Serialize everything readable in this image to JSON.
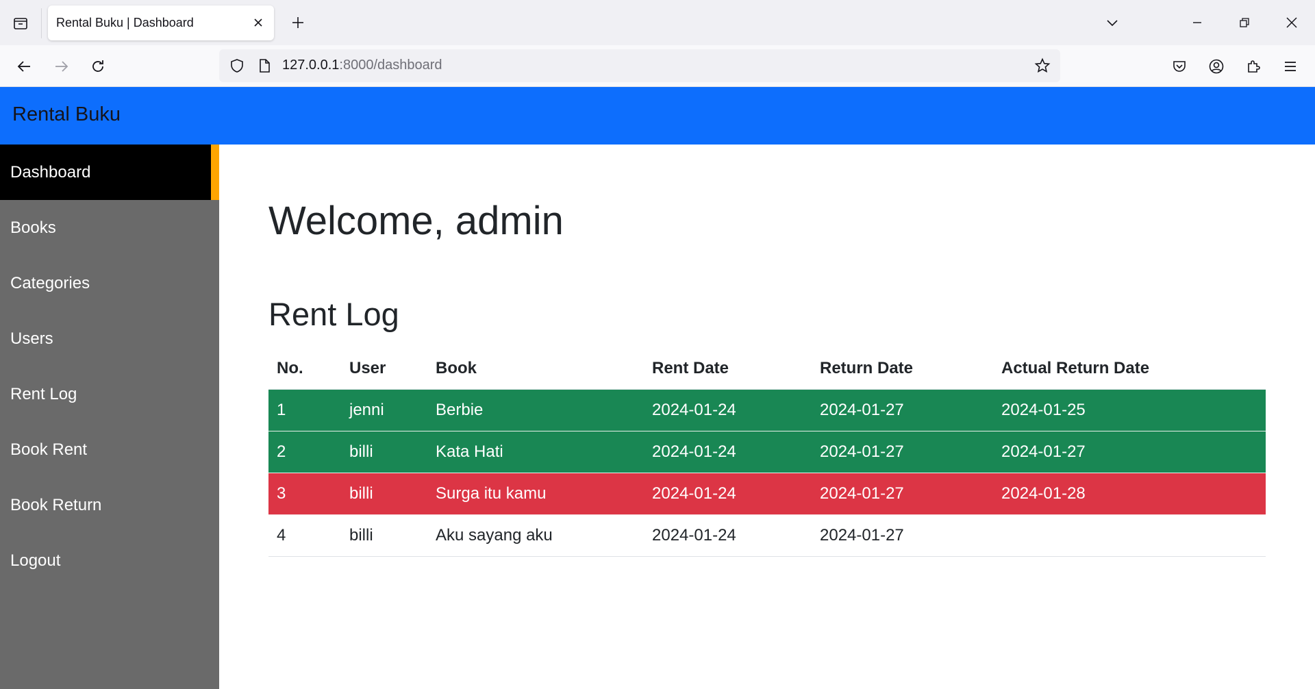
{
  "browser": {
    "tab_title": "Rental Buku | Dashboard",
    "url_host": "127.0.0.1",
    "url_rest": ":8000/dashboard",
    "icons": [
      "tab-list-icon",
      "close-icon",
      "plus-icon",
      "chevron-down-icon",
      "minimize-icon",
      "restore-icon",
      "window-close-icon",
      "back-arrow-icon",
      "forward-arrow-icon",
      "reload-icon",
      "shield-icon",
      "page-icon",
      "star-icon",
      "pocket-icon",
      "account-icon",
      "extensions-icon",
      "menu-icon"
    ]
  },
  "app": {
    "brand": "Rental Buku",
    "header_color": "#0d6efd"
  },
  "sidebar": {
    "active_color": "#000000",
    "indicator_color": "#ffa500",
    "items": [
      {
        "label": "Dashboard"
      },
      {
        "label": "Books"
      },
      {
        "label": "Categories"
      },
      {
        "label": "Users"
      },
      {
        "label": "Rent Log"
      },
      {
        "label": "Book Rent"
      },
      {
        "label": "Book Return"
      },
      {
        "label": "Logout"
      }
    ]
  },
  "main": {
    "welcome": "Welcome, admin",
    "section_title": "Rent Log",
    "table": {
      "headers": [
        "No.",
        "User",
        "Book",
        "Rent Date",
        "Return Date",
        "Actual Return Date"
      ],
      "rows": [
        {
          "no": "1",
          "user": "jenni",
          "book": "Berbie",
          "rent_date": "2024-01-24",
          "return_date": "2024-01-27",
          "actual_return_date": "2024-01-25",
          "status_color": "#198754"
        },
        {
          "no": "2",
          "user": "billi",
          "book": "Kata Hati",
          "rent_date": "2024-01-24",
          "return_date": "2024-01-27",
          "actual_return_date": "2024-01-27",
          "status_color": "#198754"
        },
        {
          "no": "3",
          "user": "billi",
          "book": "Surga itu kamu",
          "rent_date": "2024-01-24",
          "return_date": "2024-01-27",
          "actual_return_date": "2024-01-28",
          "status_color": "#dc3545"
        },
        {
          "no": "4",
          "user": "billi",
          "book": "Aku sayang aku",
          "rent_date": "2024-01-24",
          "return_date": "2024-01-27",
          "actual_return_date": "",
          "status_color": ""
        }
      ]
    }
  }
}
